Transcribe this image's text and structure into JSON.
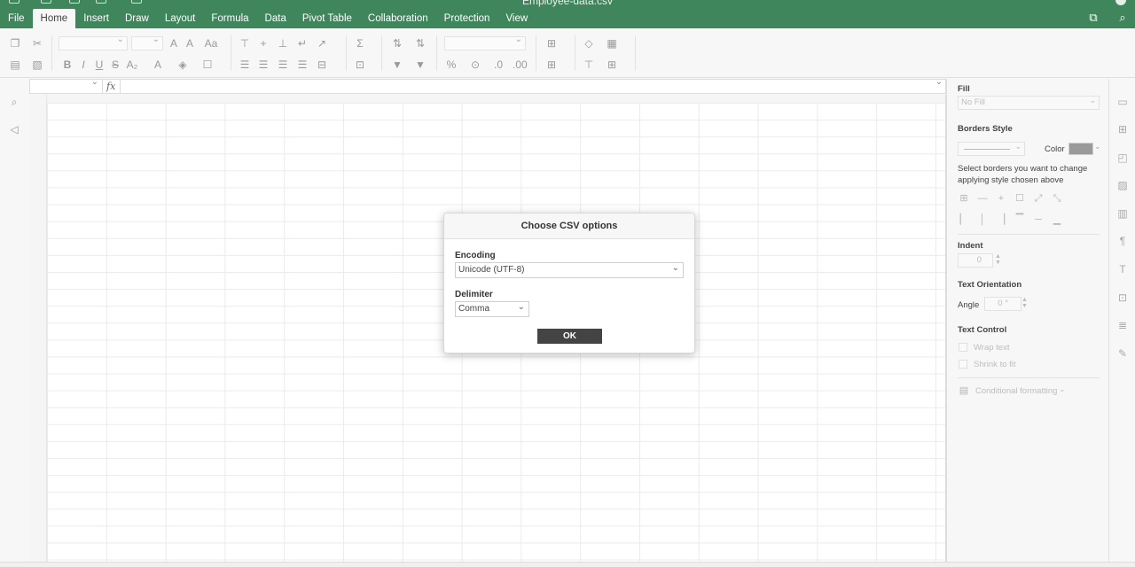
{
  "title_bar": {
    "document_title": "Employee-data.csv",
    "accent_color": "#40865c"
  },
  "menu": {
    "tabs": [
      "File",
      "Home",
      "Insert",
      "Draw",
      "Layout",
      "Formula",
      "Data",
      "Pivot Table",
      "Collaboration",
      "Protection",
      "View"
    ],
    "active_tab": "Home"
  },
  "formula_bar": {
    "fx_label": "fx",
    "name_box_value": "",
    "formula_value": ""
  },
  "dialog": {
    "title": "Choose CSV options",
    "encoding": {
      "label": "Encoding",
      "selected": "Unicode (UTF-8)"
    },
    "delimiter": {
      "label": "Delimiter",
      "selected": "Comma"
    },
    "ok_label": "OK"
  },
  "right_panel": {
    "fill": {
      "heading": "Fill",
      "value": "No Fill"
    },
    "borders": {
      "heading": "Borders Style",
      "color_label": "Color",
      "color_value": "#9a9a9a",
      "hint": "Select borders you want to change applying style chosen above"
    },
    "indent": {
      "heading": "Indent",
      "value": "0"
    },
    "orientation": {
      "heading": "Text Orientation",
      "angle_label": "Angle",
      "angle_value": "0 °"
    },
    "text_control": {
      "heading": "Text Control",
      "wrap_label": "Wrap text",
      "shrink_label": "Shrink to fit"
    },
    "conditional_formatting_label": "Conditional formatting"
  }
}
